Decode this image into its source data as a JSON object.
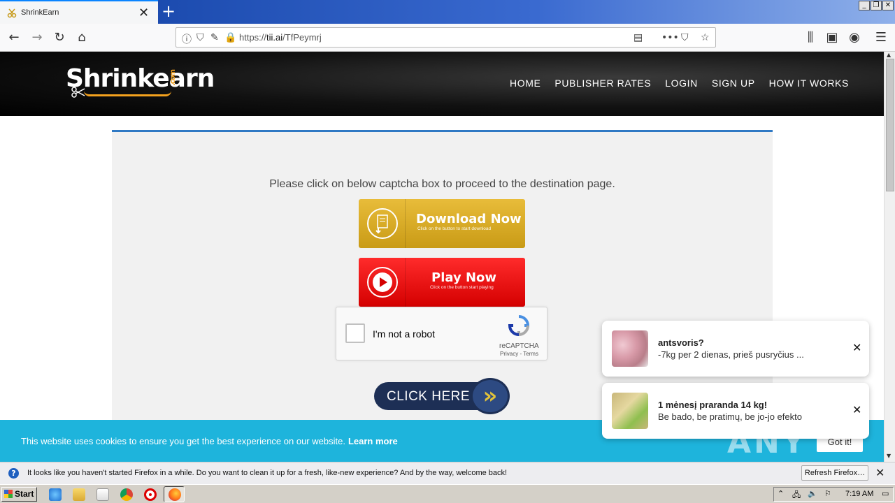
{
  "browser": {
    "tab_title": "ShrinkEarn",
    "url_prefix": "https://",
    "url_host": "tii.ai",
    "url_path": "/TfPeymrj"
  },
  "site": {
    "logo_text": "Shrinkearn",
    "logo_com": ".com",
    "nav": [
      "HOME",
      "PUBLISHER RATES",
      "LOGIN",
      "SIGN UP",
      "HOW IT WORKS"
    ]
  },
  "main": {
    "instruction": "Please click on below captcha box to proceed to the destination page.",
    "download_label": "Download Now",
    "download_sub": "Click on the button to start download",
    "play_label": "Play Now",
    "play_sub": "Click on the button start playing",
    "captcha_text": "I'm not a robot",
    "captcha_brand": "reCAPTCHA",
    "captcha_terms": "Privacy - Terms",
    "click_here": "CLICK HERE"
  },
  "cookie": {
    "message": "This website uses cookies to ensure you get the best experience on our website.",
    "learn_more": "Learn more",
    "got_it": "Got it!"
  },
  "notifications": [
    {
      "title": "antsvoris?",
      "body": "-7kg per 2 dienas, prieš pusryčius ..."
    },
    {
      "title": "1 mėnesį praranda 14 kg!",
      "body": "Be bado, be pratimų, be jo-jo efekto"
    }
  ],
  "firefox_bar": {
    "message": "It looks like you haven't started Firefox in a while. Do you want to clean it up for a fresh, like-new experience? And by the way, welcome back!",
    "refresh_label": "Refresh Firefox…"
  },
  "taskbar": {
    "start": "Start",
    "clock": "7:19 AM"
  },
  "watermark": "ANY RUN",
  "colors": {
    "cookie_bg": "#1eb4dc",
    "panel_accent": "#2f79c4",
    "logo_orange": "#f4a21e"
  }
}
